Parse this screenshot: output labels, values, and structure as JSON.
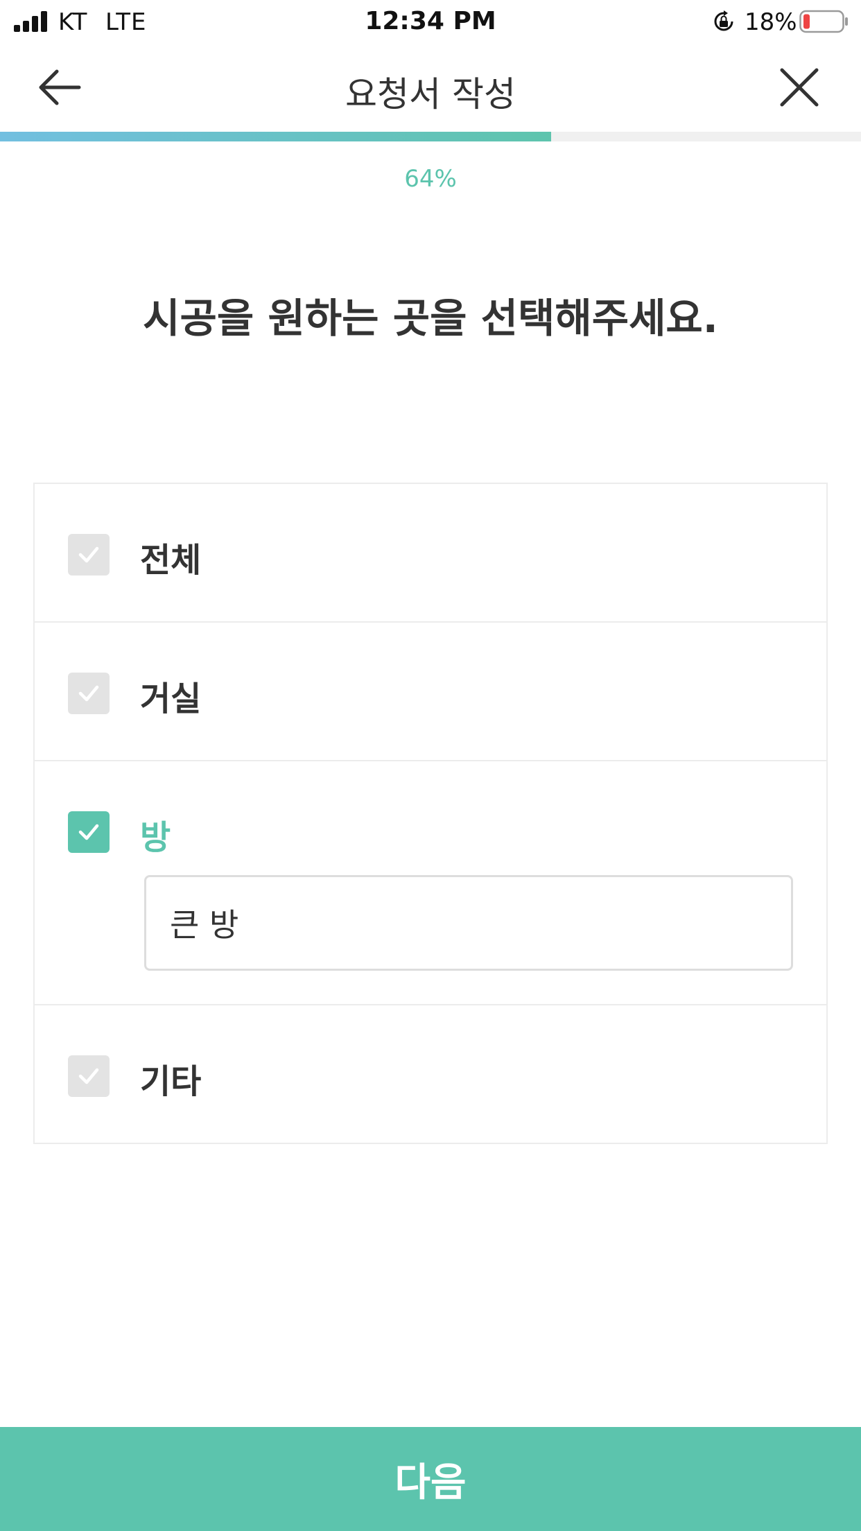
{
  "status_bar": {
    "carrier": "KT",
    "network": "LTE",
    "time": "12:34 PM",
    "battery": "18%",
    "icons": [
      "signal-icon",
      "orientation-lock-icon",
      "battery-icon"
    ]
  },
  "header": {
    "title": "요청서 작성",
    "back_icon": "arrow-left-icon",
    "close_icon": "close-icon"
  },
  "progress": {
    "value": 0.64,
    "label": "64%"
  },
  "question": "시공을 원하는 곳을 선택해주세요.",
  "options": [
    {
      "label": "전체",
      "checked": false
    },
    {
      "label": "거실",
      "checked": false
    },
    {
      "label": "방",
      "checked": true,
      "detail_value": "큰 방"
    },
    {
      "label": "기타",
      "checked": false
    }
  ],
  "footer": {
    "next_label": "다음"
  },
  "colors": {
    "accent": "#5cc4ad",
    "progress_gradient_start": "#72bfe0",
    "unchecked_box": "#e3e3e3",
    "text": "#333333",
    "battery_low": "#ee4444"
  }
}
